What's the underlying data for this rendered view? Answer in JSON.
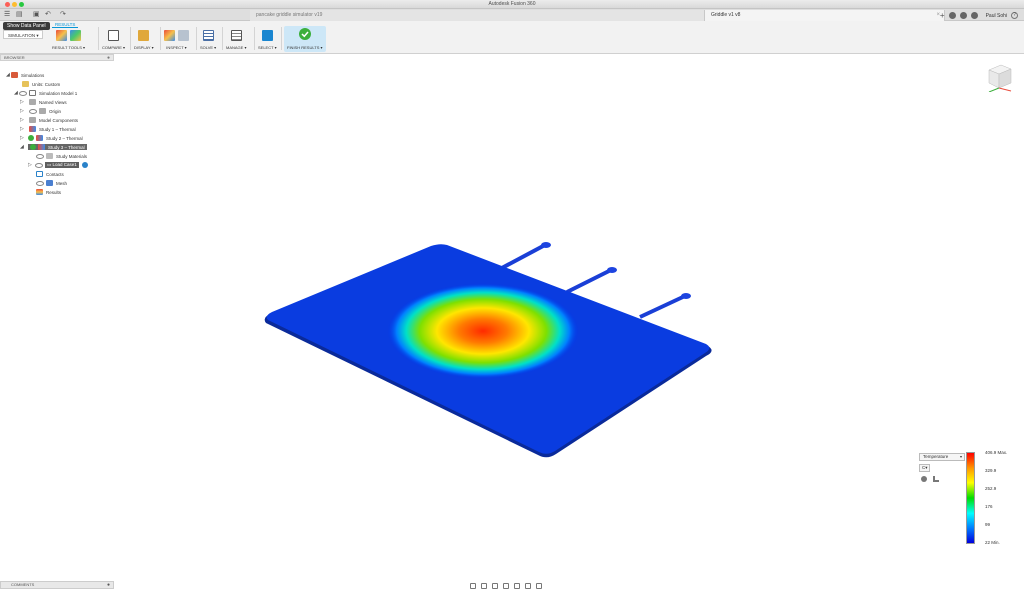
{
  "app": {
    "title": "Autodesk Fusion 360"
  },
  "tabs": [
    {
      "label": "pancake griddle simulator v19",
      "active": false
    },
    {
      "label": "Griddle v1 v8",
      "active": true
    }
  ],
  "user": {
    "name": "Paul Sohi"
  },
  "tooltip": "Show Data Panel",
  "toolbar": {
    "tab_label": "RESULTS",
    "workspace": "SIMULATION ▾",
    "groups": [
      {
        "label": "RESULT TOOLS ▾"
      },
      {
        "label": "COMPARE ▾"
      },
      {
        "label": "DISPLAY ▾"
      },
      {
        "label": "INSPECT ▾"
      },
      {
        "label": "SOLVE ▾"
      },
      {
        "label": "MANAGE ▾"
      },
      {
        "label": "SELECT ▾"
      },
      {
        "label": "FINISH RESULTS ▾"
      }
    ]
  },
  "browser": {
    "title": "BROWSER",
    "items": [
      {
        "label": "Simulations"
      },
      {
        "label": "Units: Custom"
      },
      {
        "label": "Simulation Model 1"
      },
      {
        "label": "Named Views"
      },
      {
        "label": "Origin"
      },
      {
        "label": "Model Components"
      },
      {
        "label": "Study 1 – Thermal"
      },
      {
        "label": "Study 2 – Thermal"
      },
      {
        "label": "Study 3 – Thermal"
      },
      {
        "label": "Study Materials"
      },
      {
        "label": "Load Case1"
      },
      {
        "label": "Contacts"
      },
      {
        "label": "Mesh"
      },
      {
        "label": "Results"
      }
    ]
  },
  "comments": {
    "label": "COMMENTS"
  },
  "legend": {
    "result_type": "Temperature",
    "unit": "C",
    "labels": [
      "406.9 Max.",
      "329.9",
      "252.9",
      "176",
      "99",
      "22 Min."
    ],
    "max": 406.9,
    "min": 22
  },
  "colors": {
    "accent": "#0696d7",
    "hot": "#ff2200",
    "cold": "#0000dd"
  }
}
